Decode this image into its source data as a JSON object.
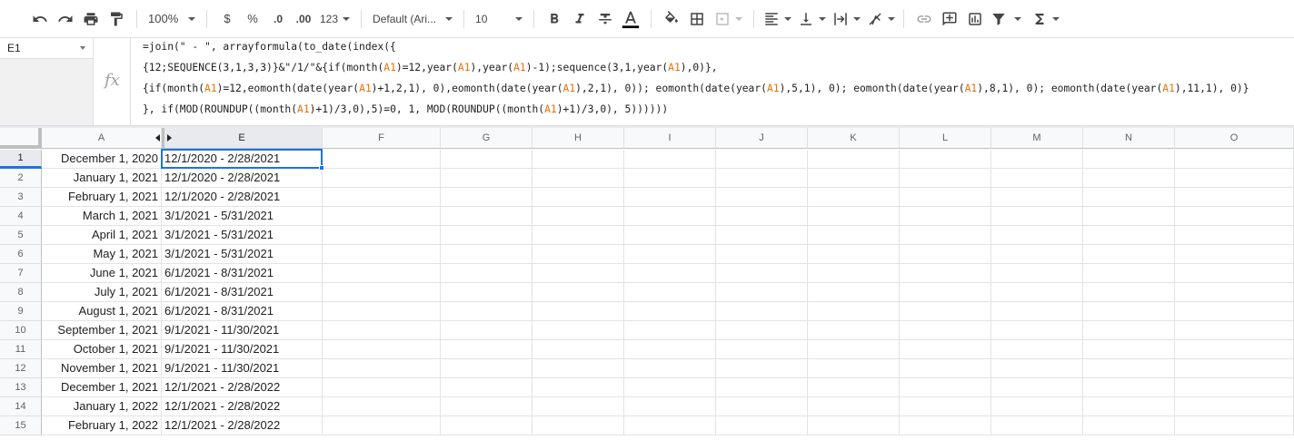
{
  "toolbar": {
    "zoom": "100%",
    "currency_label": "$",
    "percent_label": "%",
    "decrease_decimal_label": ".0",
    "increase_decimal_label": ".00",
    "more_formats_label": "123",
    "font_family": "Default (Ari...",
    "font_size": "10"
  },
  "namebox": {
    "value": "E1"
  },
  "formula": {
    "fx_label": "fx",
    "lines": [
      "=join(\" - \", arrayformula(to_date(index({",
      "{12;SEQUENCE(3,1,3,3)}&\"/1/\"&{if(month(A1)=12,year(A1),year(A1)-1);sequence(3,1,year(A1),0)},",
      "{if(month(A1)=12,eomonth(date(year(A1)+1,2,1), 0),eomonth(date(year(A1),2,1), 0)); eomonth(date(year(A1),5,1), 0); eomonth(date(year(A1),8,1), 0); eomonth(date(year(A1),11,1), 0)}",
      "}, if(MOD(ROUNDUP((month(A1)+1)/3,0),5)=0, 1, MOD(ROUNDUP((month(A1)+1)/3,0), 5))))))"
    ]
  },
  "columns": [
    "A",
    "E",
    "F",
    "G",
    "H",
    "I",
    "J",
    "K",
    "L",
    "M",
    "N",
    "O"
  ],
  "rows": [
    {
      "num": "1",
      "a": "December 1, 2020",
      "e": "12/1/2020 - 2/28/2021"
    },
    {
      "num": "2",
      "a": "January 1, 2021",
      "e": "12/1/2020 - 2/28/2021"
    },
    {
      "num": "3",
      "a": "February 1, 2021",
      "e": "12/1/2020 - 2/28/2021"
    },
    {
      "num": "4",
      "a": "March 1, 2021",
      "e": "3/1/2021 - 5/31/2021"
    },
    {
      "num": "5",
      "a": "April 1, 2021",
      "e": "3/1/2021 - 5/31/2021"
    },
    {
      "num": "6",
      "a": "May 1, 2021",
      "e": "3/1/2021 - 5/31/2021"
    },
    {
      "num": "7",
      "a": "June 1, 2021",
      "e": "6/1/2021 - 8/31/2021"
    },
    {
      "num": "8",
      "a": "July 1, 2021",
      "e": "6/1/2021 - 8/31/2021"
    },
    {
      "num": "9",
      "a": "August 1, 2021",
      "e": "6/1/2021 - 8/31/2021"
    },
    {
      "num": "10",
      "a": "September 1, 2021",
      "e": "9/1/2021 - 11/30/2021"
    },
    {
      "num": "11",
      "a": "October 1, 2021",
      "e": "9/1/2021 - 11/30/2021"
    },
    {
      "num": "12",
      "a": "November 1, 2021",
      "e": "9/1/2021 - 11/30/2021"
    },
    {
      "num": "13",
      "a": "December 1, 2021",
      "e": "12/1/2021 - 2/28/2022"
    },
    {
      "num": "14",
      "a": "January 1, 2022",
      "e": "12/1/2021 - 2/28/2022"
    },
    {
      "num": "15",
      "a": "February 1, 2022",
      "e": "12/1/2021 - 2/28/2022"
    }
  ],
  "colors": {
    "selection": "#1a73e8",
    "cell_reference": "#e8710a"
  }
}
